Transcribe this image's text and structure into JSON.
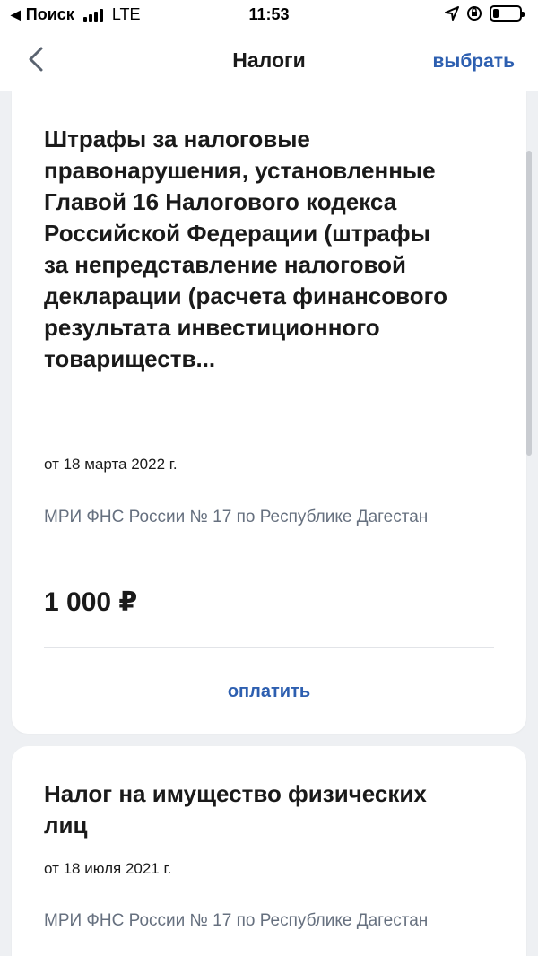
{
  "status_bar": {
    "back_app": "Поиск",
    "network": "LTE",
    "time": "11:53",
    "battery_level": 0.2
  },
  "nav": {
    "title": "Налоги",
    "action_label": "выбрать"
  },
  "cards": [
    {
      "title": "Штрафы за налоговые правонарушения, установленные Главой 16 Налогового кодекса Российской Федерации (штрафы за непредставление налоговой декларации (расчета финансового результата инвестиционного товариществ...",
      "date": "от 18 марта 2022 г.",
      "org": "МРИ ФНС России № 17 по Республике Дагестан",
      "amount": "1 000 ₽",
      "pay_label": "оплатить"
    },
    {
      "title": "Налог на имущество физических лиц",
      "date": "от 18 июля 2021 г.",
      "org": "МРИ ФНС России № 17 по Республике Дагестан"
    }
  ],
  "colors": {
    "accent": "#2d5fb0",
    "background": "#eef0f3",
    "secondary_text": "#66707f"
  }
}
